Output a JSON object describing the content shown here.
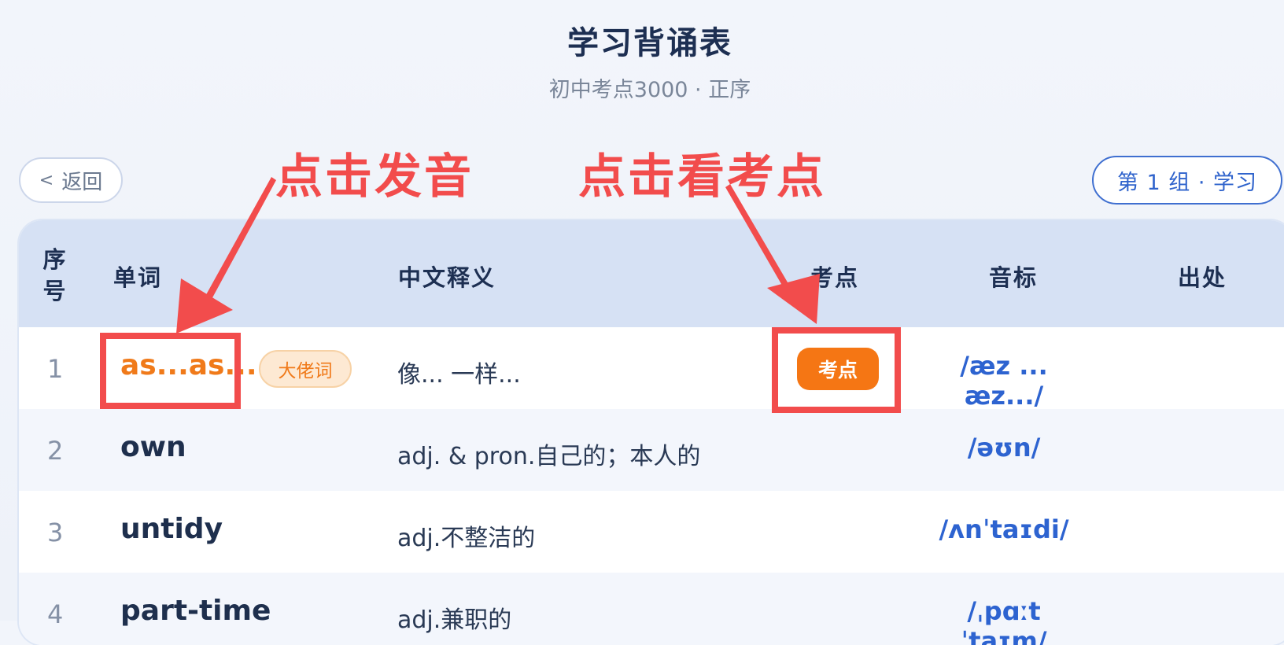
{
  "header": {
    "title": "学习背诵表",
    "subtitle": "初中考点3000 · 正序"
  },
  "nav": {
    "back_icon": "<",
    "back_label": "返回",
    "group_label": "第 1 组 · 学习"
  },
  "table": {
    "columns": [
      "序\n号",
      "单词",
      "中文释义",
      "考点",
      "音标",
      "出处"
    ],
    "rows": [
      {
        "index": "1",
        "word": "as...as...",
        "tag": "大佬词",
        "meaning": "像... 一样...",
        "point": "考点",
        "phonetic": "/æz ... æz.../"
      },
      {
        "index": "2",
        "word": "own",
        "tag": "",
        "meaning": "adj. & pron.自己的；本人的",
        "point": "",
        "phonetic": "/əʊn/"
      },
      {
        "index": "3",
        "word": "untidy",
        "tag": "",
        "meaning": "adj.不整洁的",
        "point": "",
        "phonetic": "/ʌnˈtaɪdi/"
      },
      {
        "index": "4",
        "word": "part-time",
        "tag": "",
        "meaning": "adj.兼职的",
        "point": "",
        "phonetic": "/ˌpɑːtˈtaɪm/"
      }
    ]
  },
  "annotations": {
    "pronounce": "点击发音",
    "view_point": "点击看考点"
  },
  "colors": {
    "accent_orange": "#f57614",
    "annotation_red": "#f24c4c",
    "phonetic_blue": "#2d63d0"
  }
}
